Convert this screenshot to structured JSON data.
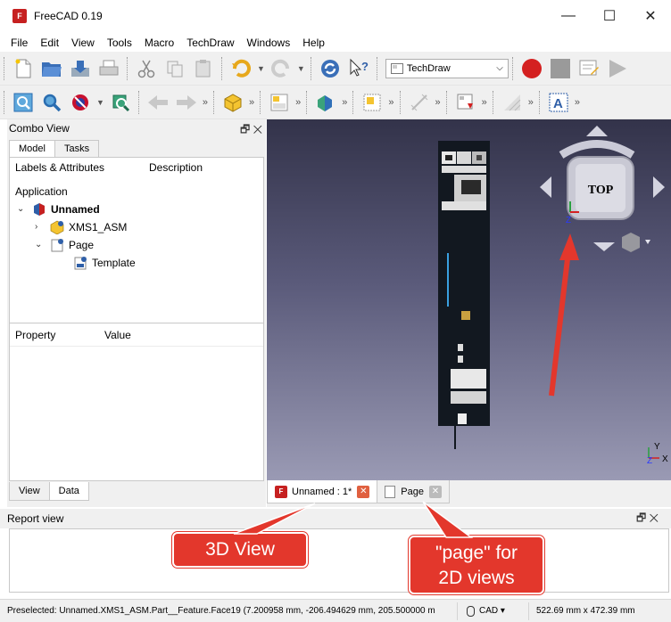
{
  "app": {
    "title": "FreeCAD 0.19",
    "logo_text": "F"
  },
  "window_controls": {
    "minimize": "—",
    "maximize": "☐",
    "close": "✕"
  },
  "menu": [
    "File",
    "Edit",
    "View",
    "Tools",
    "Macro",
    "TechDraw",
    "Windows",
    "Help"
  ],
  "toolbar": {
    "workbench": "TechDraw",
    "more": "»"
  },
  "combo_view": {
    "title": "Combo View",
    "dock_buttons": "🗗 ✕",
    "tabs": [
      "Model",
      "Tasks"
    ],
    "tree_headers": [
      "Labels & Attributes",
      "Description"
    ],
    "tree_root": "Application",
    "tree": {
      "unnamed": "Unnamed",
      "xms1": "XMS1_ASM",
      "page": "Page",
      "template": "Template"
    },
    "prop_headers": [
      "Property",
      "Value"
    ],
    "bottom_tabs": [
      "View",
      "Data"
    ]
  },
  "navcube": {
    "face_label": "TOP"
  },
  "axis": {
    "x": "X",
    "y": "Y",
    "z": "Z"
  },
  "doc_tabs": [
    {
      "label": "Unnamed : 1*",
      "close": "✕"
    },
    {
      "label": "Page",
      "close": "✕"
    }
  ],
  "report_view": {
    "title": "Report view",
    "dock_buttons": "🗗 ✕"
  },
  "status": {
    "message": "Preselected: Unnamed.XMS1_ASM.Part__Feature.Face19 (7.200958 mm, -206.494629 mm, 205.500000 m",
    "nav_style": "CAD ▾",
    "dimensions": "522.69 mm x 472.39 mm"
  },
  "callouts": {
    "view3d": "3D View",
    "page_line1": "\"page\" for",
    "page_line2": "2D views"
  },
  "colors": {
    "annotation": "#e3372c",
    "background_top": "#33334a",
    "background_bottom": "#9a9ab4"
  }
}
